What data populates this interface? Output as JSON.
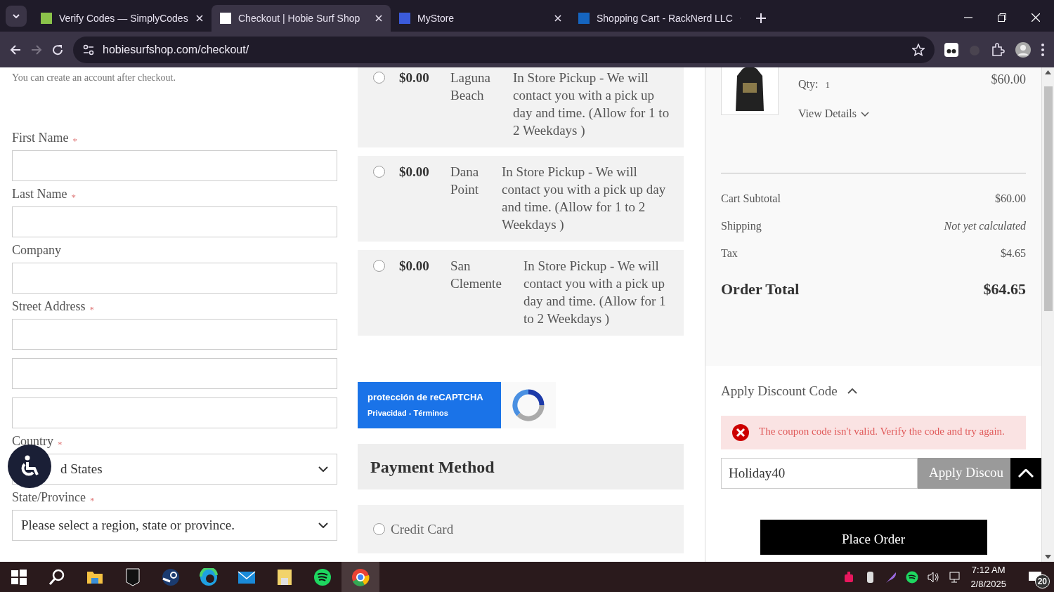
{
  "browser": {
    "tabs": [
      {
        "title": "Verify Codes — SimplyCodes",
        "selected": false,
        "color": "#8bc34a"
      },
      {
        "title": "Checkout | Hobie Surf Shop",
        "selected": true,
        "color": "#ffffff"
      },
      {
        "title": "MyStore",
        "selected": false,
        "color": "#3b5bdb"
      },
      {
        "title": "Shopping Cart - RackNerd LLC",
        "selected": false,
        "color": "#1565c0"
      }
    ],
    "url": "hobiesurfshop.com/checkout/"
  },
  "form": {
    "note": "You can create an account after checkout.",
    "fields": [
      {
        "kind": "text",
        "label": "First Name",
        "required_mark": "*"
      },
      {
        "kind": "text",
        "label": "Last Name",
        "required_mark": "*"
      },
      {
        "kind": "text",
        "label": "Company"
      },
      {
        "kind": "address",
        "label": "Street Address",
        "required_mark": "*"
      },
      {
        "kind": "select",
        "label": "Country",
        "required_mark": "*",
        "value": "d States"
      },
      {
        "kind": "select",
        "label": "State/Province",
        "required_mark": "*",
        "value": "Please select a region, state or province."
      }
    ]
  },
  "shipping": {
    "methods": [
      {
        "price": "$0.00",
        "store": "Laguna Beach",
        "description": "In Store Pickup - We will contact you with a pick up day and time. (Allow for 1 to 2 Weekdays )",
        "selected": false
      },
      {
        "price": "$0.00",
        "store": "Dana Point",
        "description": "In Store Pickup - We will contact you with a pick up day and time. (Allow for 1 to 2 Weekdays )",
        "selected": false
      },
      {
        "price": "$0.00",
        "store": "San Clemente",
        "description": "In Store Pickup - We will contact you with a pick up day and time. (Allow for 1 to 2 Weekdays )",
        "selected": false
      }
    ]
  },
  "recaptcha": {
    "title": "protección de reCAPTCHA",
    "links": "Privacidad - Términos"
  },
  "payment": {
    "title": "Payment Method",
    "options": [
      {
        "label": "Credit Card",
        "selected": false
      }
    ]
  },
  "summary": {
    "item": {
      "qty_label": "Qty:",
      "qty": "1",
      "price": "$60.00",
      "details": "View Details"
    },
    "totals": [
      {
        "kind": "normal",
        "label": "Cart Subtotal",
        "value": "$60.00"
      },
      {
        "kind": "pending",
        "label": "Shipping",
        "value": "Not yet calculated"
      },
      {
        "kind": "normal",
        "label": "Tax",
        "value": "$4.65"
      },
      {
        "kind": "grand",
        "label": "Order Total",
        "value": "$64.65"
      }
    ],
    "discount": {
      "title": "Apply Discount Code",
      "expanded": true,
      "error": "The coupon code isn't valid. Verify the code and try again.",
      "code": "Holiday40",
      "button": "Apply Discou"
    },
    "place_order": "Place Order"
  },
  "taskbar": {
    "time": "7:12 AM",
    "date": "2/8/2025",
    "notifications": "20"
  }
}
